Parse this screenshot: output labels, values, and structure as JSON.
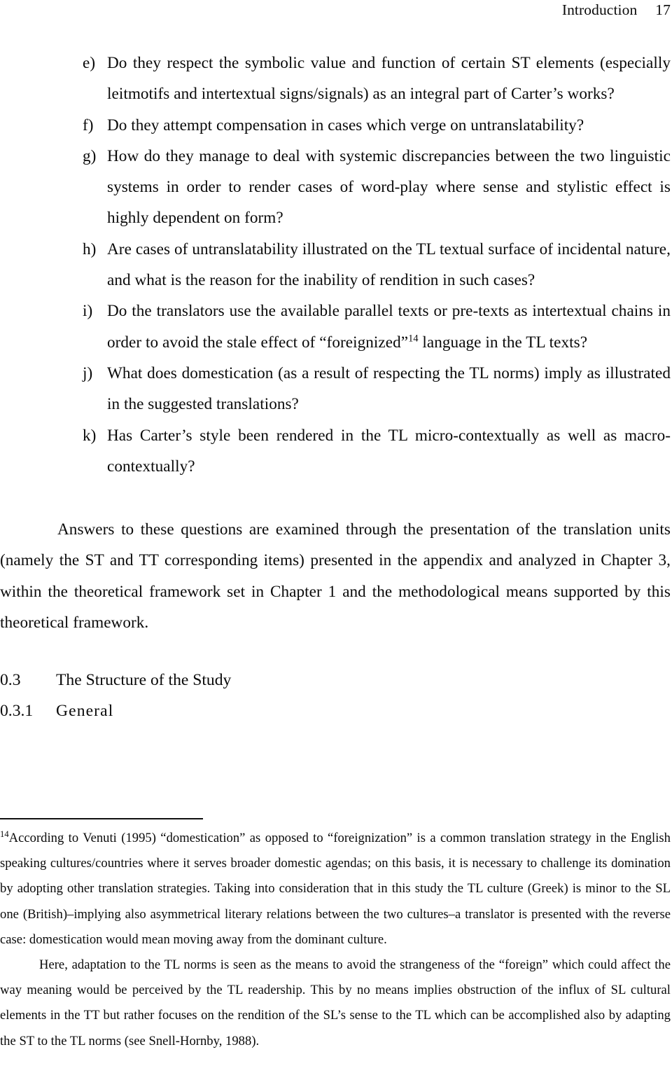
{
  "page": {
    "running_head_title": "Introduction",
    "running_head_page_number": "17"
  },
  "questions": [
    {
      "marker": "e)",
      "text": "Do they respect the symbolic value and function of certain ST elements (especially leitmotifs and intertextual signs/signals) as an integral part of Carter’s works?"
    },
    {
      "marker": "f)",
      "text": "Do they attempt compensation in cases which verge on untranslatability?"
    },
    {
      "marker": "g)",
      "text": "How do they manage to deal with systemic discrepancies between the two linguistic systems in order to render cases of word-play where sense and stylistic effect is highly dependent on form?"
    },
    {
      "marker": "h)",
      "text": "Are cases of untranslatability illustrated on the TL textual surface of incidental nature, and what is the reason for the inability of rendition in such cases?"
    },
    {
      "marker": "i)",
      "text_before_ref": "Do the translators use the available parallel texts or pre-texts as intertextual chains in order to avoid the stale effect of “foreignized”",
      "footnote_ref": "14",
      "text_after_ref": " language in the TL texts?"
    },
    {
      "marker": "j)",
      "text": "What does domestication (as a result of respecting the TL norms) imply as illustrated in the suggested translations?"
    },
    {
      "marker": "k)",
      "text": "Has Carter’s style been rendered in the TL micro-contextually as well as macro-contextually?"
    }
  ],
  "body_paragraph": "Answers to these questions are examined through the presentation of the translation units (namely the ST and TT corresponding items) presented in the appendix and analyzed in Chapter 3, within the theoretical framework set in Chapter 1 and the methodological means supported by this theoretical framework.",
  "headings": {
    "section": {
      "number": "0.3",
      "label": "The Structure of the Study"
    },
    "subsection": {
      "number": "0.3.1",
      "label": "General"
    }
  },
  "footnote": {
    "marker": "14",
    "paragraph_1": "According to Venuti (1995) “domestication” as opposed to “foreignization” is a common translation strategy in the English speaking cultures/countries where it serves broader domestic agendas; on this basis, it is necessary to challenge its domination by adopting other translation strategies. Taking into consideration that in this study the TL culture (Greek) is minor to the SL one (British)–implying also asymmetrical literary relations between the two cultures–a translator is presented with the reverse case: domestication would mean moving away from the dominant culture.",
    "paragraph_2": "Here, adaptation to the TL norms is seen as the means to avoid the strangeness of the “foreign” which could affect the way meaning would be perceived by the TL readership. This by no means implies obstruction of the influx of SL cultural elements in the TT but rather focuses on the rendition of the SL’s sense to the TL which can be accomplished also by adapting the ST to the TL norms (see Snell-Hornby, 1988)."
  }
}
